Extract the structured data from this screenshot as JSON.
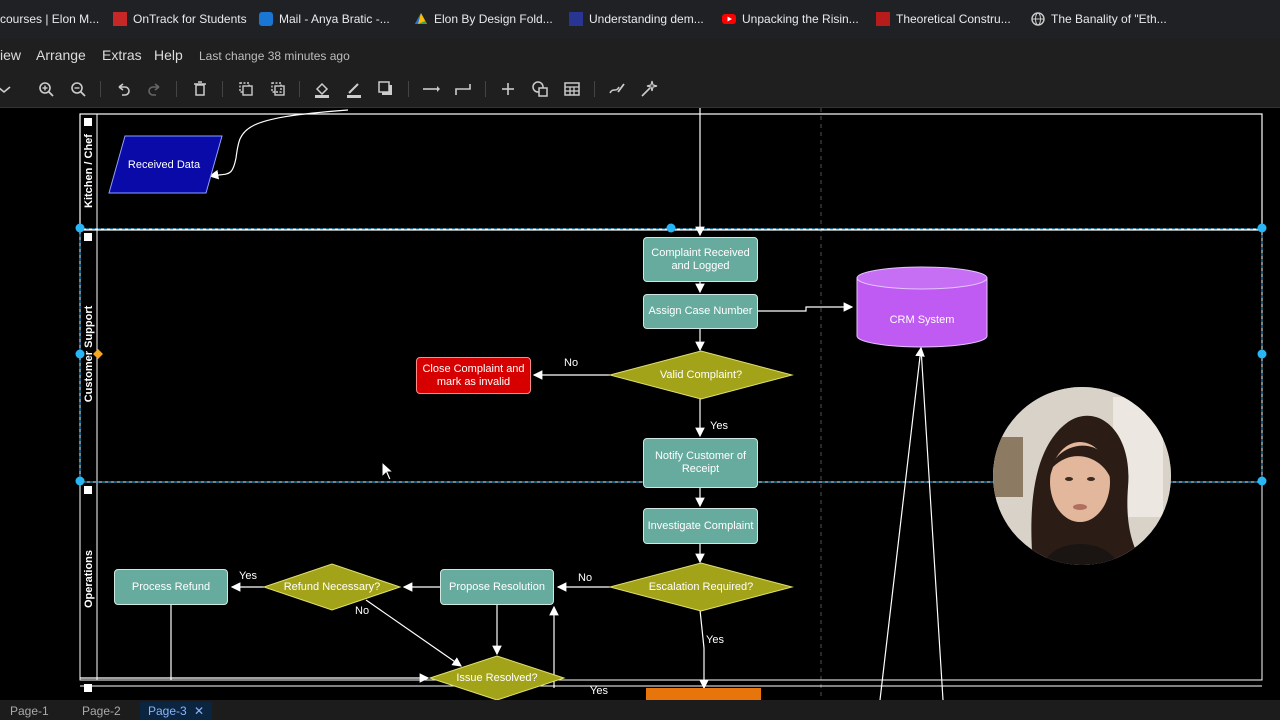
{
  "bookmarks": [
    {
      "label": "courses | Elon M...",
      "icon": "bookmark-icon"
    },
    {
      "label": "OnTrack for Students",
      "icon": "ontrack-icon"
    },
    {
      "label": "Mail - Anya Bratic -...",
      "icon": "outlook-icon"
    },
    {
      "label": "Elon By Design Fold...",
      "icon": "drive-icon"
    },
    {
      "label": "Understanding dem...",
      "icon": "page-icon"
    },
    {
      "label": "Unpacking the Risin...",
      "icon": "youtube-icon"
    },
    {
      "label": "Theoretical Constru...",
      "icon": "library-icon"
    },
    {
      "label": "The Banality of \"Eth...",
      "icon": "globe-icon"
    }
  ],
  "menu": {
    "items": [
      "iew",
      "Arrange",
      "Extras",
      "Help"
    ],
    "last_change": "Last change 38 minutes ago"
  },
  "toolbar": {
    "icons": [
      "dropdown-icon",
      "zoom-in-icon",
      "zoom-out-icon",
      "undo-icon",
      "redo-icon",
      "delete-icon",
      "to-front-icon",
      "to-back-icon",
      "fill-color-icon",
      "line-color-icon",
      "shadow-icon",
      "connection-icon",
      "waypoints-icon",
      "insert-icon",
      "shapes-icon",
      "table-icon",
      "freehand-icon",
      "magic-icon"
    ]
  },
  "lanes": {
    "kitchen": "Kitchen / Chef",
    "support": "Customer Support",
    "operations": "Operations"
  },
  "nodes": {
    "received_data": "Received Data",
    "complaint_logged": "Complaint Received and Logged",
    "assign_case": "Assign Case Number",
    "crm": "CRM System",
    "valid": "Valid Complaint?",
    "close_invalid": "Close Complaint and mark as invalid",
    "notify": "Notify Customer of Receipt",
    "investigate": "Investigate Complaint",
    "escalation": "Escalation Required?",
    "propose": "Propose Resolution",
    "refund_q": "Refund Necessary?",
    "process_refund": "Process Refund",
    "resolved": "Issue Resolved?"
  },
  "edge_labels": {
    "no_valid": "No",
    "yes_valid": "Yes",
    "no_escalation": "No",
    "yes_escalation": "Yes",
    "yes_refund": "Yes",
    "no_refund": "No",
    "yes_resolved": "Yes"
  },
  "pages": [
    "Page-1",
    "Page-2",
    "Page-3"
  ],
  "colors": {
    "process": "#67ab9f",
    "decision": "#a3a31a",
    "invalid": "#d60000",
    "crm": "#bf5af2",
    "input": "#0a0aa8"
  }
}
